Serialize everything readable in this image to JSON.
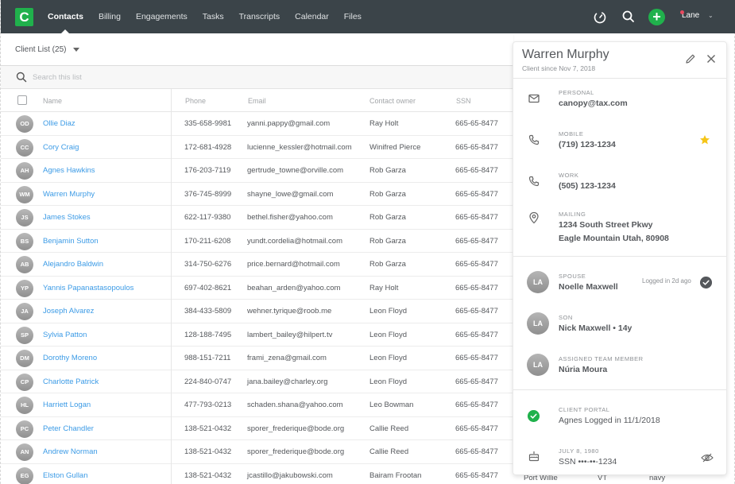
{
  "app": {
    "logo_letter": "C",
    "nav": [
      {
        "label": "Contacts",
        "active": true
      },
      {
        "label": "Billing"
      },
      {
        "label": "Engagements"
      },
      {
        "label": "Tasks"
      },
      {
        "label": "Transcripts"
      },
      {
        "label": "Calendar"
      },
      {
        "label": "Files"
      }
    ],
    "user": "Lane",
    "icons": {
      "timer": "stopwatch-icon",
      "search": "search-icon",
      "add": "plus-icon",
      "user_menu": "chevron-down-icon"
    },
    "colors": {
      "nav_bg": "#3b4449",
      "accent_green": "#20b14c",
      "link_blue": "#3c9be6",
      "notification_dot": "#e84a5f",
      "star_yellow": "#f5c518"
    }
  },
  "list": {
    "title": "Client List (25)",
    "search_placeholder": "Search this list",
    "columns": {
      "name": "Name",
      "phone": "Phone",
      "email": "Email",
      "owner": "Contact owner",
      "ssn": "SSN"
    },
    "rows": [
      {
        "initials": "OD",
        "name": "Ollie Diaz",
        "phone": "335-658-9981",
        "email": "yanni.pappy@gmail.com",
        "owner": "Ray Holt",
        "ssn": "665-65-8477"
      },
      {
        "initials": "CC",
        "name": "Cory Craig",
        "phone": "172-681-4928",
        "email": "lucienne_kessler@hotmail.com",
        "owner": "Winifred Pierce",
        "ssn": "665-65-8477"
      },
      {
        "initials": "AH",
        "name": "Agnes Hawkins",
        "phone": "176-203-7119",
        "email": "gertrude_towne@orville.com",
        "owner": "Rob Garza",
        "ssn": "665-65-8477"
      },
      {
        "initials": "WM",
        "name": "Warren Murphy",
        "phone": "376-745-8999",
        "email": "shayne_lowe@gmail.com",
        "owner": "Rob Garza",
        "ssn": "665-65-8477"
      },
      {
        "initials": "JS",
        "name": "James Stokes",
        "phone": "622-117-9380",
        "email": "bethel.fisher@yahoo.com",
        "owner": "Rob Garza",
        "ssn": "665-65-8477"
      },
      {
        "initials": "BS",
        "name": "Benjamin Sutton",
        "phone": "170-211-6208",
        "email": "yundt.cordelia@hotmail.com",
        "owner": "Rob Garza",
        "ssn": "665-65-8477"
      },
      {
        "initials": "AB",
        "name": "Alejandro Baldwin",
        "phone": "314-750-6276",
        "email": "price.bernard@hotmail.com",
        "owner": "Rob Garza",
        "ssn": "665-65-8477"
      },
      {
        "initials": "YP",
        "name": "Yannis Papanastasopoulos",
        "phone": "697-402-8621",
        "email": "beahan_arden@yahoo.com",
        "owner": "Ray Holt",
        "ssn": "665-65-8477"
      },
      {
        "initials": "JA",
        "name": "Joseph Alvarez",
        "phone": "384-433-5809",
        "email": "wehner.tyrique@roob.me",
        "owner": "Leon Floyd",
        "ssn": "665-65-8477"
      },
      {
        "initials": "SP",
        "name": "Sylvia Patton",
        "phone": "128-188-7495",
        "email": "lambert_bailey@hilpert.tv",
        "owner": "Leon Floyd",
        "ssn": "665-65-8477"
      },
      {
        "initials": "DM",
        "name": "Dorothy Moreno",
        "phone": "988-151-7211",
        "email": "frami_zena@gmail.com",
        "owner": "Leon Floyd",
        "ssn": "665-65-8477"
      },
      {
        "initials": "CP",
        "name": "Charlotte Patrick",
        "phone": "224-840-0747",
        "email": "jana.bailey@charley.org",
        "owner": "Leon Floyd",
        "ssn": "665-65-8477"
      },
      {
        "initials": "HL",
        "name": "Harriett Logan",
        "phone": "477-793-0213",
        "email": "schaden.shana@yahoo.com",
        "owner": "Leo Bowman",
        "ssn": "665-65-8477"
      },
      {
        "initials": "PC",
        "name": "Peter Chandler",
        "phone": "138-521-0432",
        "email": "sporer_frederique@bode.org",
        "owner": "Callie Reed",
        "ssn": "665-65-8477"
      },
      {
        "initials": "AN",
        "name": "Andrew Norman",
        "phone": "138-521-0432",
        "email": "sporer_frederique@bode.org",
        "owner": "Callie Reed",
        "ssn": "665-65-8477"
      },
      {
        "initials": "EG",
        "name": "Elston Gullan",
        "phone": "138-521-0432",
        "email": "jcastillo@jakubowski.com",
        "owner": "Bairam Frootan",
        "ssn": "665-65-8477"
      }
    ],
    "hidden_columns_peek": {
      "city": "Port Willie",
      "state": "VT",
      "color": "navy"
    }
  },
  "detail": {
    "name": "Warren Murphy",
    "since": "Client since Nov 7, 2018",
    "contact": [
      {
        "icon": "envelope-icon",
        "label": "PERSONAL",
        "value": "canopy@tax.com"
      },
      {
        "icon": "phone-icon",
        "label": "MOBILE",
        "value": "(719) 123-1234",
        "starred": true
      },
      {
        "icon": "phone-icon",
        "label": "WORK",
        "value": "(505) 123-1234"
      },
      {
        "icon": "map-pin-icon",
        "label": "MAILING",
        "value": "1234 South Street Pkwy",
        "value2": "Eagle Mountain Utah, 80908"
      }
    ],
    "relations": [
      {
        "initials": "LA",
        "label": "SPOUSE",
        "value": "Noelle Maxwell",
        "status": "Logged in 2d ago",
        "verified": true
      },
      {
        "initials": "LA",
        "label": "SON",
        "value": "Nick Maxwell • 14y"
      },
      {
        "initials": "LA",
        "label": "ASSIGNED TEAM MEMBER",
        "value": "Núria Moura"
      }
    ],
    "portal": {
      "label": "CLIENT PORTAL",
      "value": "Agnes Logged in 11/1/2018"
    },
    "birthday": {
      "label": "JULY 8, 1980",
      "value": "SSN •••-••-1234"
    }
  }
}
